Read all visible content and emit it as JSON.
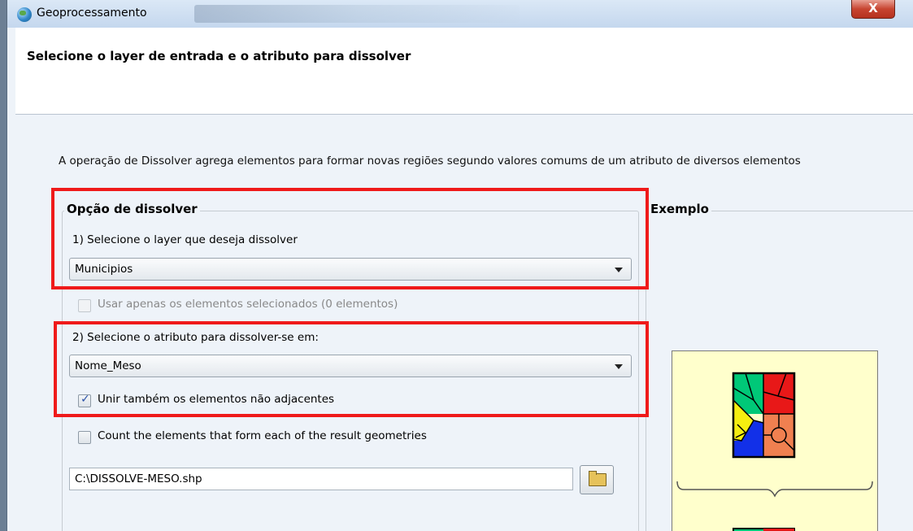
{
  "window": {
    "title": "Geoprocessamento",
    "close_label": "X"
  },
  "header": {
    "heading": "Selecione o layer de entrada e o atributo para dissolver"
  },
  "description": "A operação de Dissolver agrega elementos para formar novas regiões segundo valores comums de um atributo de diversos elementos",
  "dissolve_group": {
    "legend": "Opção de dissolver",
    "step1_label": "1) Selecione o layer que deseja dissolver",
    "layer_value": "Municipios",
    "selected_only_label": "Usar apenas os elementos selecionados (0 elementos)",
    "selected_only_checked": false,
    "step2_label": "2) Selecione o atributo para dissolver-se em:",
    "attribute_value": "Nome_Meso",
    "join_nonadjacent_label": "Unir também os elementos não adjacentes",
    "join_nonadjacent_checked": true,
    "count_elements_label": "Count the elements that form each of the result geometries",
    "count_elements_checked": false,
    "output_path": "C:\\DISSOLVE-MESO.shp"
  },
  "example_group": {
    "legend": "Exemplo"
  },
  "colors": {
    "highlight": "#ef1a1a",
    "example_background": "#ffffcc"
  }
}
